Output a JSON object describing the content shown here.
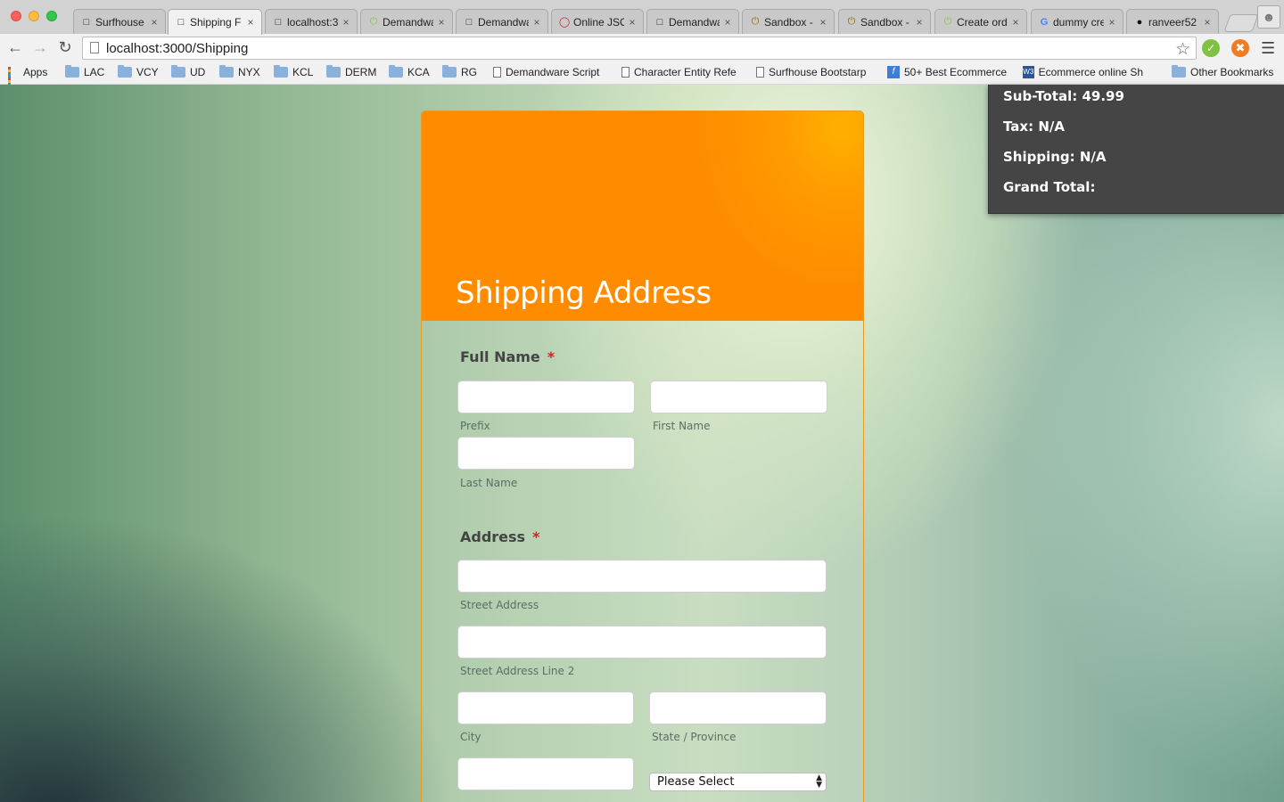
{
  "browser": {
    "tabs": [
      {
        "label": "Surfhouse",
        "icon": "page-icon"
      },
      {
        "label": "Shipping F",
        "icon": "page-icon"
      },
      {
        "label": "localhost:3",
        "icon": "page-icon"
      },
      {
        "label": "Demandwa",
        "icon": "power-icon"
      },
      {
        "label": "Demandwa",
        "icon": "page-icon"
      },
      {
        "label": "Online JSO",
        "icon": "ring-icon"
      },
      {
        "label": "Demandwa",
        "icon": "page-icon"
      },
      {
        "label": "Sandbox -",
        "icon": "power-icon"
      },
      {
        "label": "Sandbox -",
        "icon": "power-icon"
      },
      {
        "label": "Create ord",
        "icon": "power-icon"
      },
      {
        "label": "dummy cre",
        "icon": "google-icon"
      },
      {
        "label": "ranveer52",
        "icon": "github-icon"
      }
    ],
    "url": "localhost:3000/Shipping",
    "bookmarks": [
      {
        "label": "Apps",
        "type": "apps"
      },
      {
        "label": "LAC",
        "type": "folder"
      },
      {
        "label": "VCY",
        "type": "folder"
      },
      {
        "label": "UD",
        "type": "folder"
      },
      {
        "label": "NYX",
        "type": "folder"
      },
      {
        "label": "KCL",
        "type": "folder"
      },
      {
        "label": "DERM",
        "type": "folder"
      },
      {
        "label": "KCA",
        "type": "folder"
      },
      {
        "label": "RG",
        "type": "folder"
      },
      {
        "label": "Demandware Script",
        "type": "doc"
      },
      {
        "label": "Character Entity Refe",
        "type": "doc"
      },
      {
        "label": "Surfhouse Bootstarp",
        "type": "doc"
      },
      {
        "label": "50+ Best Ecommerce",
        "type": "f"
      },
      {
        "label": "Ecommerce online Sh",
        "type": "w3"
      },
      {
        "label": "Other Bookmarks",
        "type": "folder"
      }
    ]
  },
  "form": {
    "title": "Shipping Address",
    "full_name": {
      "label": "Full Name",
      "required_mark": "*",
      "prefix": "Prefix",
      "first": "First Name",
      "last": "Last Name"
    },
    "address": {
      "label": "Address",
      "required_mark": "*",
      "street": "Street Address",
      "street2": "Street Address Line 2",
      "city": "City",
      "state": "State / Province",
      "country_select": "Please Select"
    }
  },
  "totals": {
    "subtotal": "Sub-Total: 49.99",
    "tax": "Tax: N/A",
    "shipping": "Shipping: N/A",
    "grand": "Grand Total:"
  },
  "colors": {
    "header_orange": "#ff8c00",
    "required_red": "#e21a1a",
    "panel_dark": "#454545"
  }
}
